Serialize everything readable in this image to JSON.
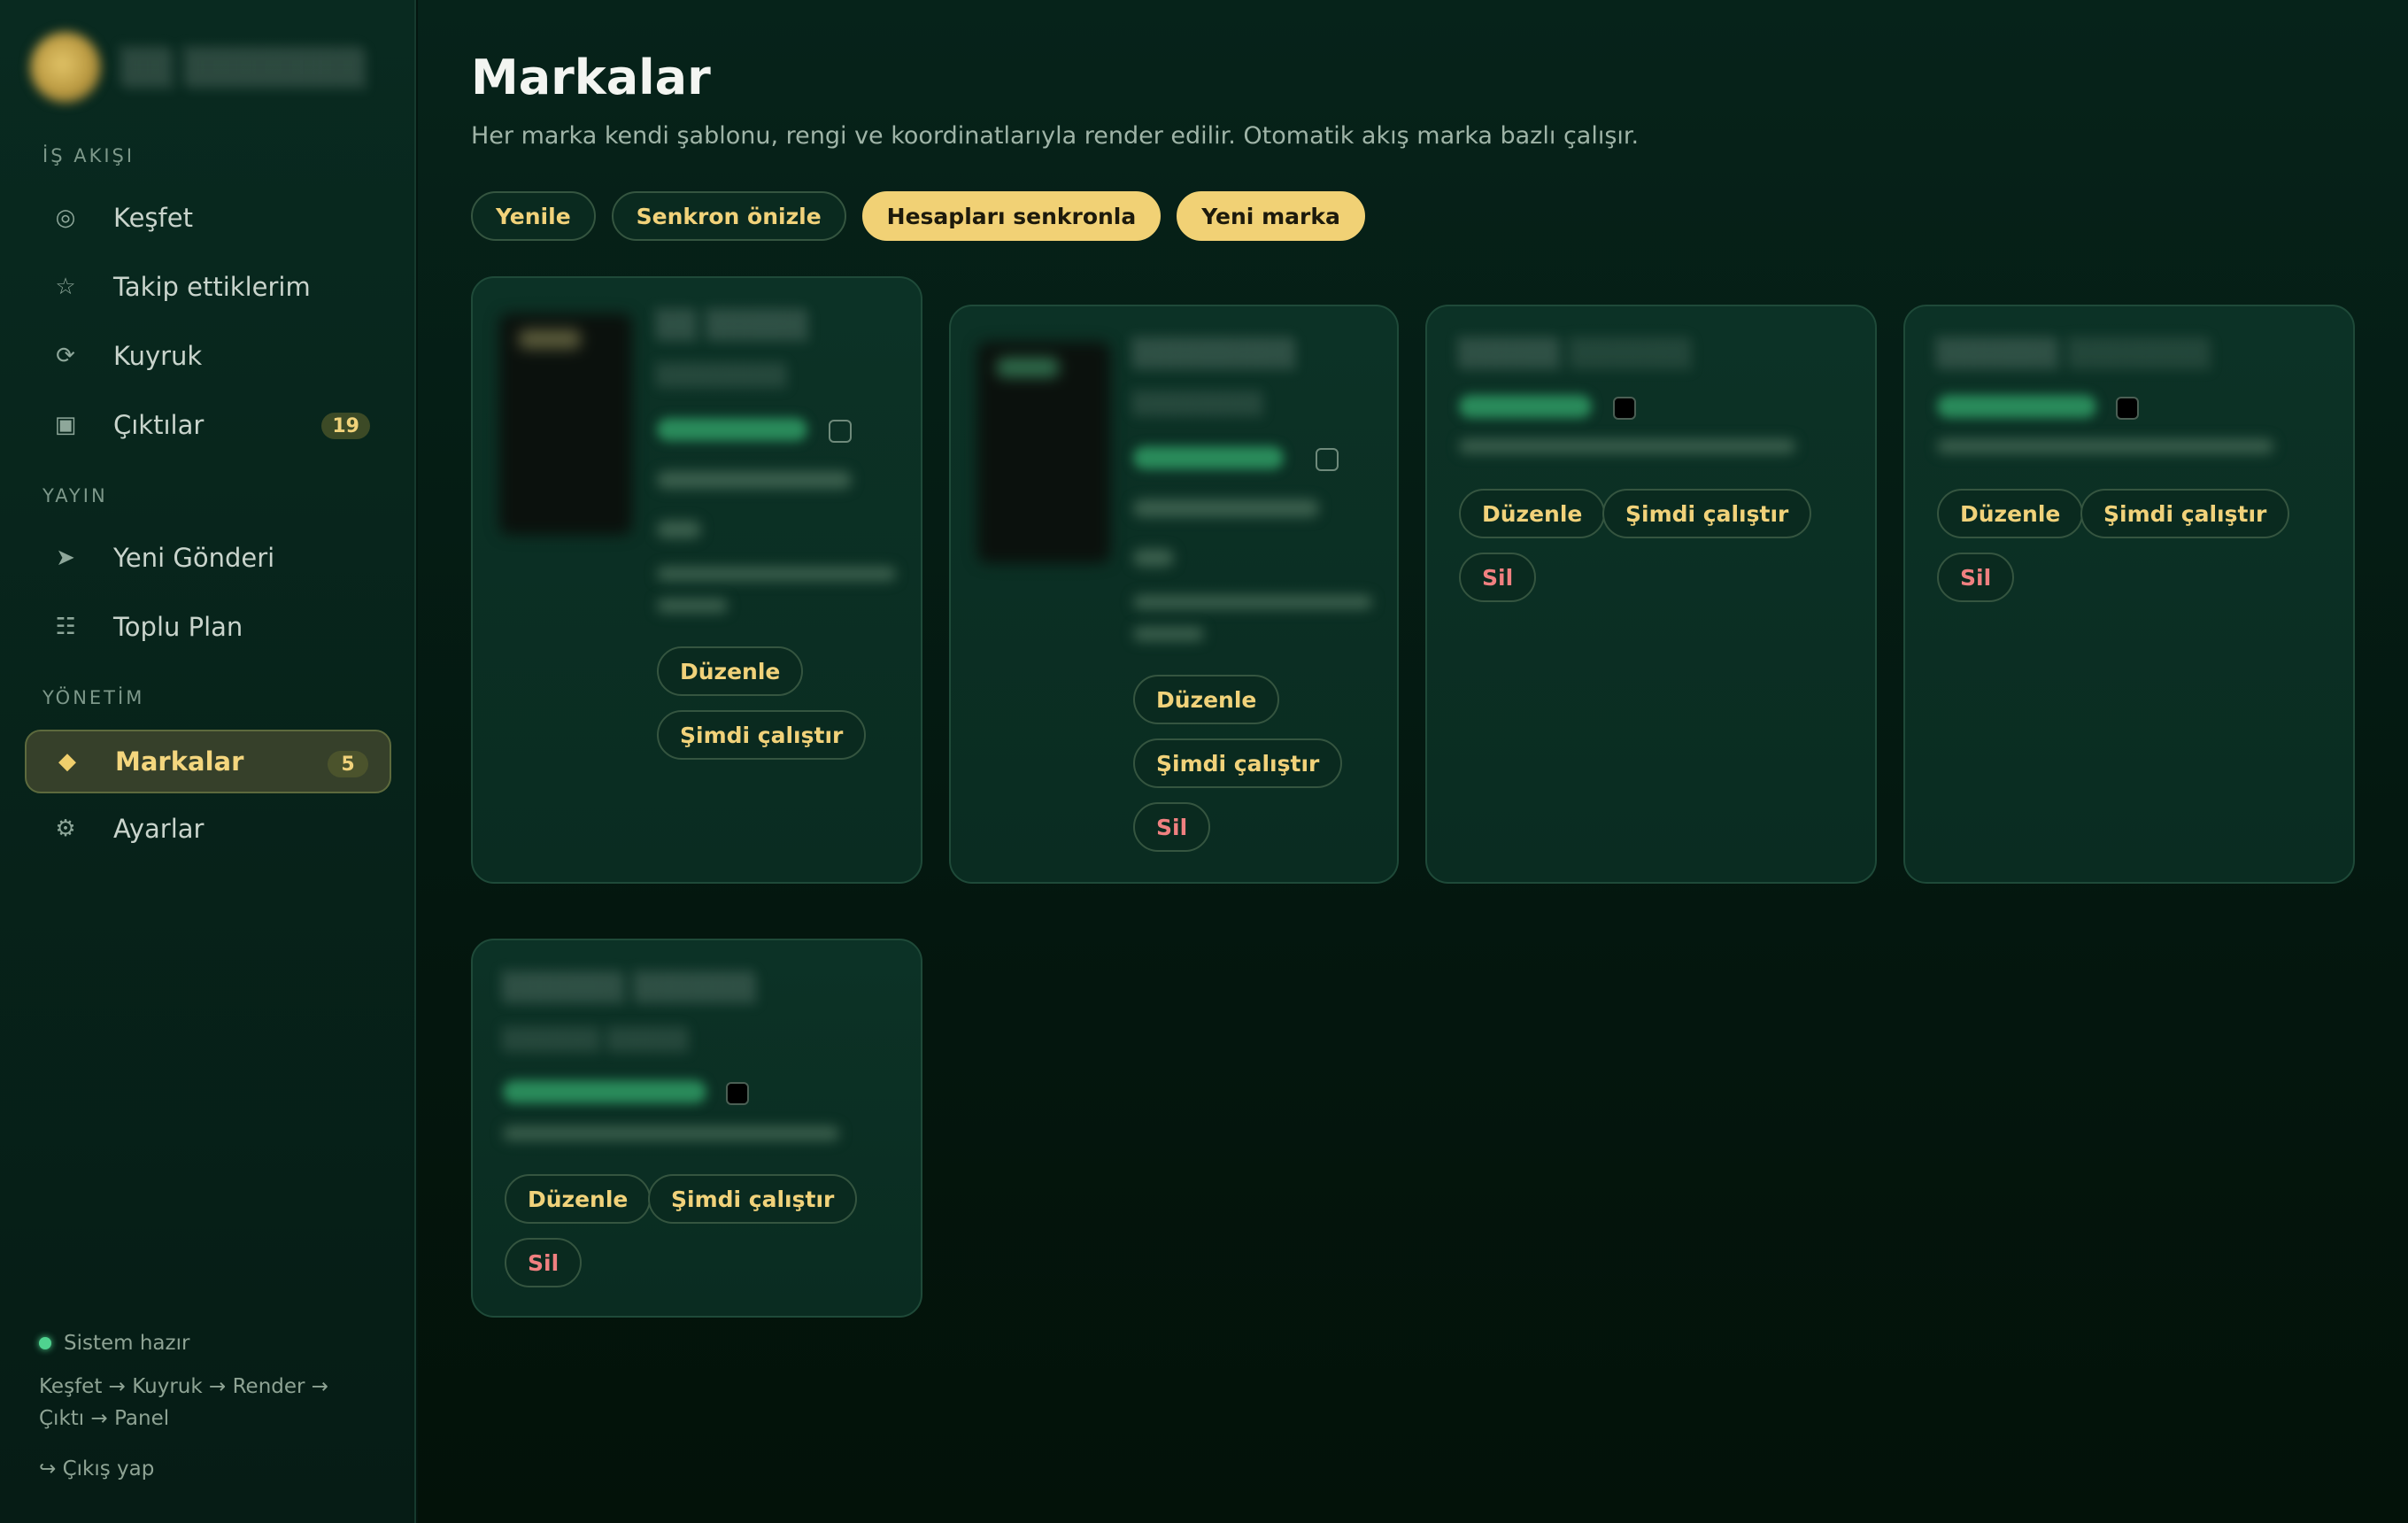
{
  "sidebar": {
    "sections": {
      "workflow": "İŞ AKIŞI",
      "publish": "YAYIN",
      "manage": "YÖNETİM"
    },
    "items": [
      {
        "label": "Keşfet",
        "icon": "target-icon",
        "glyph": "◎"
      },
      {
        "label": "Takip ettiklerim",
        "icon": "star-icon",
        "glyph": "☆"
      },
      {
        "label": "Kuyruk",
        "icon": "refresh-icon",
        "glyph": "⟳"
      },
      {
        "label": "Çıktılar",
        "icon": "output-icon",
        "glyph": "▣",
        "badge": "19"
      },
      {
        "label": "Yeni Gönderi",
        "icon": "send-icon",
        "glyph": "➤"
      },
      {
        "label": "Toplu Plan",
        "icon": "list-icon",
        "glyph": "☷"
      },
      {
        "label": "Markalar",
        "icon": "diamond-icon",
        "glyph": "◆",
        "badge": "5",
        "active": true
      },
      {
        "label": "Ayarlar",
        "icon": "gear-icon",
        "glyph": "⚙"
      }
    ],
    "footer": {
      "status": "Sistem hazır",
      "flow": "Keşfet → Kuyruk → Render → Çıktı → Panel",
      "logout": "↪ Çıkış yap"
    }
  },
  "main": {
    "title": "Markalar",
    "description": "Her marka kendi şablonu, rengi ve koordinatlarıyla render edilir. Otomatik akış marka bazlı çalışır.",
    "toolbar": {
      "refresh": "Yenile",
      "sync_preview": "Senkron önizle",
      "sync_accounts": "Hesapları senkronla",
      "new_brand": "Yeni marka"
    },
    "card_actions": {
      "edit": "Düzenle",
      "run_now": "Şimdi çalıştır",
      "delete": "Sil"
    }
  },
  "colors": {
    "accent": "#f1d175",
    "danger": "#f08080",
    "success": "#4fd38f"
  }
}
